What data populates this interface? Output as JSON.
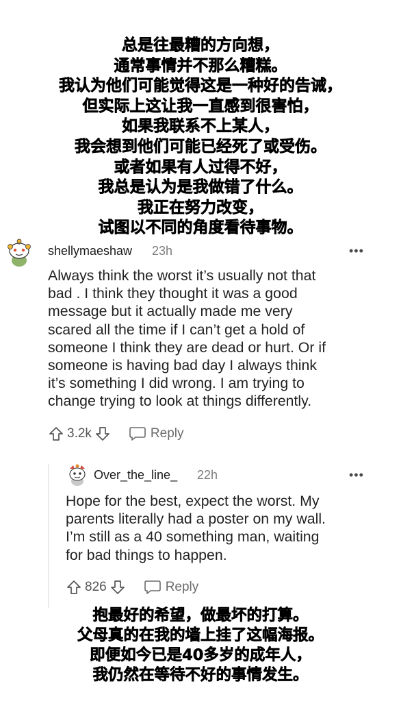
{
  "caption_top": {
    "lines": [
      "总是往最糟的方向想，",
      "通常事情并不那么糟糕。",
      "我认为他们可能觉得这是一种好的告诫，",
      "但实际上这让我一直感到很害怕，",
      "如果我联系不上某人，",
      "我会想到他们可能已经死了或受伤。",
      "或者如果有人过得不好，",
      "我总是认为是我做错了什么。",
      "我正在努力改变，",
      "试图以不同的角度看待事物。"
    ]
  },
  "comment1": {
    "username": "shellymaeshaw",
    "timestamp": "23h",
    "more_label": "•••",
    "avatar_icon": "snoo-avatar-icon",
    "body_lines": [
      "Always think the worst it’s usually not that",
      "bad . I think they thought it was a good",
      "message but it actually made me very",
      "scared all the time if I can’t get a hold of",
      "someone I think they are dead or hurt. Or if",
      "someone is having bad day I always think",
      "it’s something I did wrong. I am trying to",
      "change trying to look at things differently."
    ],
    "votes": "3.2k",
    "reply_label": "Reply"
  },
  "comment2": {
    "username": "Over_the_line_",
    "timestamp": "22h",
    "more_label": "•••",
    "avatar_icon": "snoo-avatar-icon",
    "body_lines": [
      "Hope for the best, expect the worst. My",
      "parents literally had a poster on my wall.",
      "I’m still as a 40 something man, waiting",
      "for bad things to happen."
    ],
    "votes": "826",
    "reply_label": "Reply"
  },
  "caption_bottom": {
    "lines": [
      "抱最好的希望，做最坏的打算。",
      "父母真的在我的墙上挂了这幅海报。",
      "即便如今已是40多岁的成年人，",
      "我仍然在等待不好的事情发生。"
    ]
  },
  "colors": {
    "text": "#1a1a1b",
    "meta": "#7c7c7c",
    "thread_line": "#ebebeb"
  }
}
